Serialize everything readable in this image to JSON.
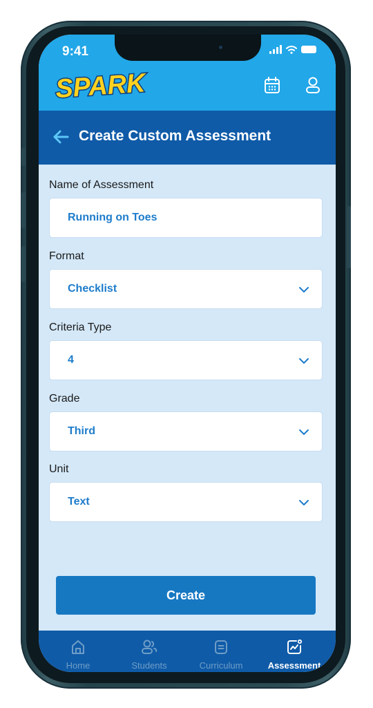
{
  "status_bar": {
    "time": "9:41"
  },
  "header": {
    "logo_text": "SPARK",
    "calendar_icon": "calendar-icon",
    "profile_icon": "user-icon"
  },
  "title_bar": {
    "title": "Create Custom Assessment",
    "back_icon": "back-arrow-icon"
  },
  "form": {
    "name": {
      "label": "Name of Assessment",
      "value": "Running on Toes"
    },
    "format": {
      "label": "Format",
      "value": "Checklist"
    },
    "criteria_type": {
      "label": "Criteria Type",
      "value": "4"
    },
    "grade": {
      "label": "Grade",
      "value": "Third"
    },
    "unit": {
      "label": "Unit",
      "value": "Text"
    }
  },
  "create_button": {
    "label": "Create"
  },
  "bottom_nav": {
    "items": [
      {
        "label": "Home",
        "icon": "home-icon",
        "active": false
      },
      {
        "label": "Students",
        "icon": "students-icon",
        "active": false
      },
      {
        "label": "Curriculum",
        "icon": "curriculum-icon",
        "active": false
      },
      {
        "label": "Assessment",
        "icon": "assessment-icon",
        "active": true
      }
    ]
  },
  "colors": {
    "header_blue": "#22a7e8",
    "title_bar_blue": "#0f5ba8",
    "background": "#d4e8f8",
    "accent_text": "#1d7ccb",
    "button_blue": "#1778c2",
    "logo_yellow": "#ffd21f"
  }
}
